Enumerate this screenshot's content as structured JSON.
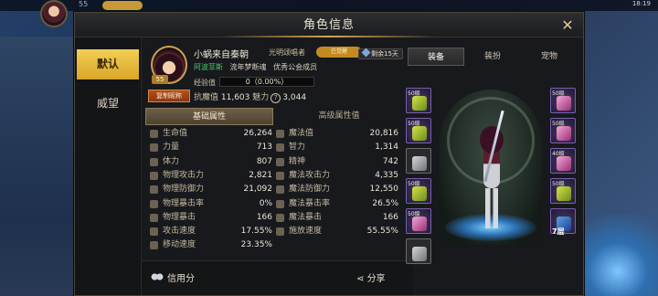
{
  "top_bar": {
    "level": "55",
    "time": "18:19"
  },
  "window": {
    "title": "角色信息",
    "close_label": "✕"
  },
  "side_tabs": [
    {
      "label": "默认",
      "active": true
    },
    {
      "label": "威望",
      "active": false
    }
  ],
  "profile": {
    "level": "55",
    "copy_label": "复制昵称",
    "name": "小蜗来自秦朝",
    "class": "光明颂唱者",
    "awaken_badge": "已觉醒",
    "tag_green": "阿波菲斯",
    "tag_server": "流年梦断魂",
    "tag_guild": "优秀公会成员",
    "exp_label": "经验值",
    "exp_value": "0（0.00%）",
    "exp_fraction": 0,
    "anti_label": "抗魔值",
    "anti_value": "11,603",
    "charm_label": "魅力",
    "charm_value": "3,044",
    "remain_label": "剩余15天"
  },
  "stat_tabs": {
    "basic": "基础属性",
    "advanced": "高级属性值"
  },
  "stats": [
    [
      {
        "label": "生命值",
        "value": "26,264"
      },
      {
        "label": "魔法值",
        "value": "20,816"
      }
    ],
    [
      {
        "label": "力量",
        "value": "713"
      },
      {
        "label": "智力",
        "value": "1,314"
      }
    ],
    [
      {
        "label": "体力",
        "value": "807"
      },
      {
        "label": "精神",
        "value": "742"
      }
    ],
    [
      {
        "label": "物理攻击力",
        "value": "2,821"
      },
      {
        "label": "魔法攻击力",
        "value": "4,335"
      }
    ],
    [
      {
        "label": "物理防御力",
        "value": "21,092"
      },
      {
        "label": "魔法防御力",
        "value": "12,550"
      }
    ],
    [
      {
        "label": "物理暴击率",
        "value": "0%"
      },
      {
        "label": "魔法暴击率",
        "value": "26.5%"
      }
    ],
    [
      {
        "label": "物理暴击",
        "value": "166"
      },
      {
        "label": "魔法暴击",
        "value": "166"
      }
    ],
    [
      {
        "label": "攻击速度",
        "value": "17.55%"
      },
      {
        "label": "施放速度",
        "value": "55.55%"
      }
    ],
    [
      {
        "label": "移动速度",
        "value": "23.35%"
      },
      null
    ]
  ],
  "bottom": {
    "credit_label": "信用分",
    "share_label": "分享"
  },
  "right_tabs": {
    "equip": "装备",
    "outfit": "装扮",
    "pet": "宠物"
  },
  "equip_left": [
    {
      "level": "50级",
      "color": "yellow"
    },
    {
      "level": "50级",
      "color": "yellow"
    },
    {
      "level": "",
      "color": "gray"
    },
    {
      "level": "50级",
      "color": "yellow"
    },
    {
      "level": "50级",
      "color": "pink"
    },
    {
      "level": "",
      "color": "gray"
    }
  ],
  "equip_right": [
    {
      "level": "50级",
      "color": "pink"
    },
    {
      "level": "50级",
      "color": "pink"
    },
    {
      "level": "40级",
      "color": "pink"
    },
    {
      "level": "50级",
      "color": "yellow"
    },
    {
      "level": "",
      "color": "blue"
    }
  ],
  "equip_badge": "7层",
  "colors": {
    "accent_gold": "#d8a629",
    "green_tag": "#47c96b",
    "border": "#4c4435"
  }
}
